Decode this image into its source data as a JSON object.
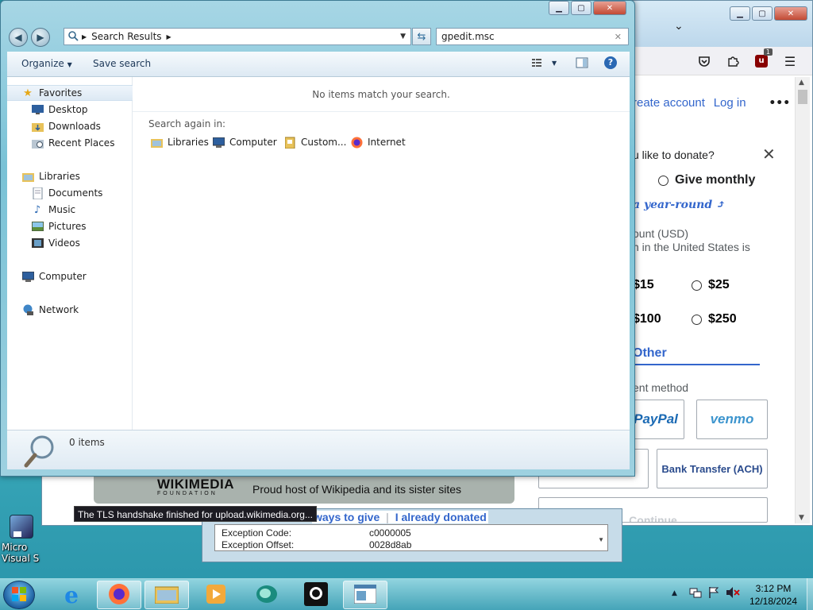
{
  "desktop": {
    "icon_label": "Micro\nVisual S"
  },
  "browser": {
    "toolbar": {
      "extension_badge": "1"
    },
    "page": {
      "header_links": {
        "create_account": "reate account",
        "log_in": "Log in",
        "more": "•••"
      },
      "question": "u like to donate?",
      "close_glyph": "✕",
      "give_monthly": "Give monthly",
      "year_round": "a year-round",
      "amount_label": "ount (USD)",
      "amount_note": "n in the United States is",
      "amounts": [
        "$15",
        "$25",
        "$100",
        "$250"
      ],
      "other": "Other",
      "payment_label": "ent method",
      "paypal": "PayPal",
      "venmo": "venmo",
      "bank_transfer": "Bank Transfer (ACH)",
      "continue": "Continue",
      "wikimedia_logo": "WIKIMEDIA",
      "wikimedia_foundation": "FOUNDATION",
      "wikimedia_host": "Proud host of Wikipedia and its sister sites",
      "ways_to_give": "ways to give",
      "already_donated": "I already donated"
    },
    "status_tooltip": "The TLS handshake finished for upload.wikimedia.org..."
  },
  "error_dialog": {
    "rows": [
      {
        "label": "Exception Code:",
        "value": "c0000005"
      },
      {
        "label": "Exception Offset:",
        "value": "0028d8ab"
      }
    ]
  },
  "explorer": {
    "address_segment": "Search Results",
    "search_value": "gpedit.msc",
    "toolbar": {
      "organize": "Organize",
      "save_search": "Save search"
    },
    "nav": {
      "favorites": "Favorites",
      "desktop": "Desktop",
      "downloads": "Downloads",
      "recent_places": "Recent Places",
      "libraries": "Libraries",
      "documents": "Documents",
      "music": "Music",
      "pictures": "Pictures",
      "videos": "Videos",
      "computer": "Computer",
      "network": "Network"
    },
    "content": {
      "empty_message": "No items match your search.",
      "search_again": "Search again in:",
      "locations": [
        "Libraries",
        "Computer",
        "Custom...",
        "Internet"
      ]
    },
    "status": {
      "items": "0 items"
    }
  },
  "taskbar": {
    "time": "3:12 PM",
    "date": "12/18/2024"
  },
  "colors": {
    "desktop": "#45b9c6",
    "wiki_link": "#3366cc",
    "venmo": "#3d95ce",
    "close_red": "#c24a34"
  }
}
